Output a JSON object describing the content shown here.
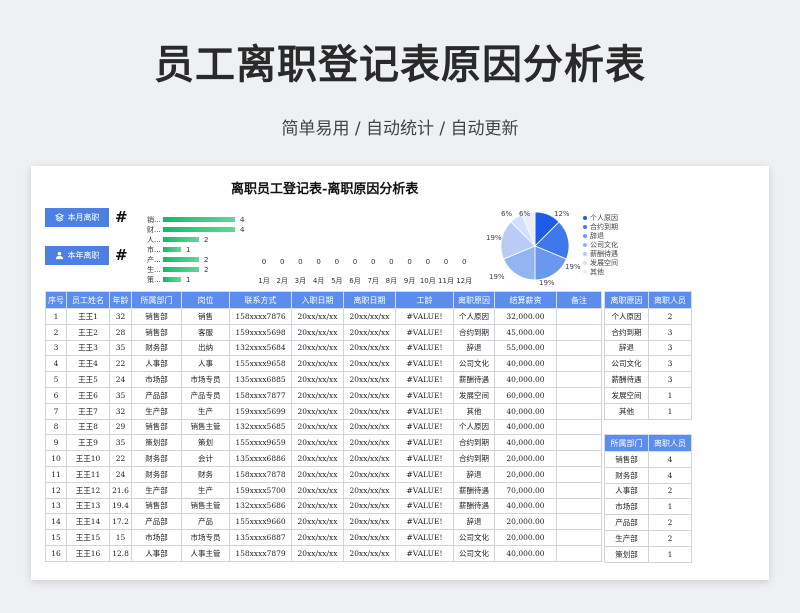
{
  "page": {
    "title": "员工离职登记表原因分析表",
    "subtitle": "简单易用  /  自动统计  /  自动更新"
  },
  "sheet": {
    "title": "离职员工登记表-离职原因分析表",
    "kpi": [
      {
        "label": "本月离职",
        "value": "#",
        "icon": "layers-icon"
      },
      {
        "label": "本年离职",
        "value": "#",
        "icon": "user-icon"
      }
    ]
  },
  "chart_data": [
    {
      "type": "bar",
      "orientation": "horizontal",
      "categories": [
        "销...",
        "财...",
        "人...",
        "市...",
        "产...",
        "生...",
        "策..."
      ],
      "values": [
        4,
        4,
        2,
        1,
        2,
        2,
        1
      ],
      "color": "#1fbf73"
    },
    {
      "type": "line",
      "categories": [
        "1月",
        "2月",
        "3月",
        "4月",
        "5月",
        "6月",
        "7月",
        "8月",
        "9月",
        "10月",
        "11月",
        "12月"
      ],
      "values": [
        0,
        0,
        0,
        0,
        0,
        0,
        0,
        0,
        0,
        0,
        0,
        0
      ]
    },
    {
      "type": "pie",
      "categories": [
        "个人原因",
        "合约到期",
        "辞退",
        "公司文化",
        "薪酬待遇",
        "发展空间",
        "其他"
      ],
      "values": [
        2,
        3,
        3,
        3,
        3,
        1,
        1
      ],
      "slice_labels": [
        "12%",
        "19%",
        "19%",
        "19%",
        "19%",
        "6%",
        "6%"
      ],
      "colors": [
        "#1e5be8",
        "#3f78ea",
        "#6a98ef",
        "#93b4f3",
        "#b8ccf7",
        "#d3e0fa",
        "#e8eefc"
      ]
    }
  ],
  "main_table": {
    "headers": [
      "序号",
      "员工姓名",
      "年龄",
      "所属部门",
      "岗位",
      "联系方式",
      "入职日期",
      "离职日期",
      "工龄",
      "离职原因",
      "结算薪资",
      "备注"
    ],
    "rows": [
      [
        "1",
        "王王1",
        "32",
        "销售部",
        "销售",
        "158xxxx7876",
        "20xx/xx/xx",
        "20xx/xx/xx",
        "#VALUE!",
        "个人原因",
        "32,000.00",
        ""
      ],
      [
        "2",
        "王王2",
        "28",
        "销售部",
        "客服",
        "159xxxx5698",
        "20xx/xx/xx",
        "20xx/xx/xx",
        "#VALUE!",
        "合约到期",
        "45,000.00",
        ""
      ],
      [
        "3",
        "王王3",
        "35",
        "财务部",
        "出纳",
        "132xxxx5684",
        "20xx/xx/xx",
        "20xx/xx/xx",
        "#VALUE!",
        "辞退",
        "55,000.00",
        ""
      ],
      [
        "4",
        "王王4",
        "22",
        "人事部",
        "人事",
        "155xxxx9658",
        "20xx/xx/xx",
        "20xx/xx/xx",
        "#VALUE!",
        "公司文化",
        "40,000.00",
        ""
      ],
      [
        "5",
        "王王5",
        "24",
        "市场部",
        "市场专员",
        "135xxxx6885",
        "20xx/xx/xx",
        "20xx/xx/xx",
        "#VALUE!",
        "薪酬待遇",
        "40,000.00",
        ""
      ],
      [
        "6",
        "王王6",
        "35",
        "产品部",
        "产品专员",
        "158xxxx7877",
        "20xx/xx/xx",
        "20xx/xx/xx",
        "#VALUE!",
        "发展空间",
        "60,000.00",
        ""
      ],
      [
        "7",
        "王王7",
        "32",
        "生产部",
        "生产",
        "159xxxx5699",
        "20xx/xx/xx",
        "20xx/xx/xx",
        "#VALUE!",
        "其他",
        "40,000.00",
        ""
      ],
      [
        "8",
        "王王8",
        "29",
        "销售部",
        "销售主管",
        "132xxxx5685",
        "20xx/xx/xx",
        "20xx/xx/xx",
        "#VALUE!",
        "个人原因",
        "40,000.00",
        ""
      ],
      [
        "9",
        "王王9",
        "35",
        "策划部",
        "策划",
        "155xxxx9659",
        "20xx/xx/xx",
        "20xx/xx/xx",
        "#VALUE!",
        "合约到期",
        "40,000.00",
        ""
      ],
      [
        "10",
        "王王10",
        "22",
        "财务部",
        "会计",
        "135xxxx6886",
        "20xx/xx/xx",
        "20xx/xx/xx",
        "#VALUE!",
        "合约到期",
        "20,000.00",
        ""
      ],
      [
        "11",
        "王王11",
        "24",
        "财务部",
        "财务",
        "158xxxx7878",
        "20xx/xx/xx",
        "20xx/xx/xx",
        "#VALUE!",
        "辞退",
        "20,000.00",
        ""
      ],
      [
        "12",
        "王王12",
        "21.6",
        "生产部",
        "生产",
        "159xxxx5700",
        "20xx/xx/xx",
        "20xx/xx/xx",
        "#VALUE!",
        "薪酬待遇",
        "70,000.00",
        ""
      ],
      [
        "13",
        "王王13",
        "19.4",
        "销售部",
        "销售主管",
        "132xxxx5686",
        "20xx/xx/xx",
        "20xx/xx/xx",
        "#VALUE!",
        "薪酬待遇",
        "40,000.00",
        ""
      ],
      [
        "14",
        "王王14",
        "17.2",
        "产品部",
        "产品",
        "155xxxx9660",
        "20xx/xx/xx",
        "20xx/xx/xx",
        "#VALUE!",
        "辞退",
        "20,000.00",
        ""
      ],
      [
        "15",
        "王王15",
        "15",
        "市场部",
        "市场专员",
        "135xxxx6887",
        "20xx/xx/xx",
        "20xx/xx/xx",
        "#VALUE!",
        "公司文化",
        "20,000.00",
        ""
      ],
      [
        "16",
        "王王16",
        "12.8",
        "人事部",
        "人事主管",
        "158xxxx7879",
        "20xx/xx/xx",
        "20xx/xx/xx",
        "#VALUE!",
        "公司文化",
        "40,000.00",
        ""
      ]
    ]
  },
  "reason_table": {
    "headers": [
      "离职原因",
      "离职人员"
    ],
    "rows": [
      [
        "个人原因",
        "2"
      ],
      [
        "合约到期",
        "3"
      ],
      [
        "辞退",
        "3"
      ],
      [
        "公司文化",
        "3"
      ],
      [
        "薪酬待遇",
        "3"
      ],
      [
        "发展空间",
        "1"
      ],
      [
        "其他",
        "1"
      ]
    ]
  },
  "dept_table": {
    "headers": [
      "所属部门",
      "离职人员"
    ],
    "rows": [
      [
        "销售部",
        "4"
      ],
      [
        "财务部",
        "4"
      ],
      [
        "人事部",
        "2"
      ],
      [
        "市场部",
        "1"
      ],
      [
        "产品部",
        "2"
      ],
      [
        "生产部",
        "2"
      ],
      [
        "策划部",
        "1"
      ]
    ]
  }
}
